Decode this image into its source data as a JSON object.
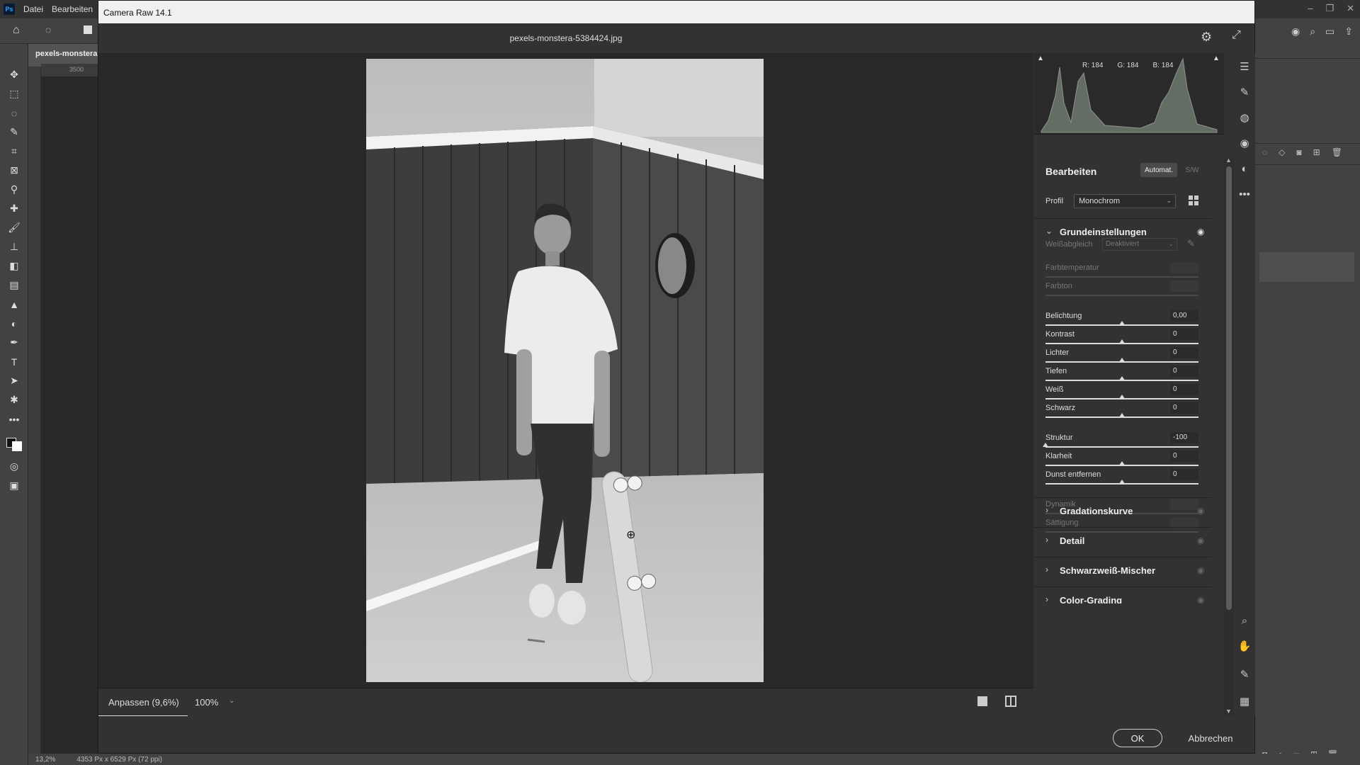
{
  "ps": {
    "logo": "Ps",
    "menu": [
      "Datei",
      "Bearbeiten"
    ],
    "doc_tab": "pexels-monstera",
    "ruler_h_label": "3500",
    "zoom_status": "13,2%",
    "size_status": "4353 Px x 6529 Px (72 ppi)"
  },
  "dialog": {
    "title": "Camera Raw 14.1",
    "filename": "pexels-monstera-5384424.jpg",
    "zoom_fit": "Anpassen (9,6%)",
    "zoom_level": "100%",
    "ok": "OK",
    "cancel": "Abbrechen"
  },
  "histogram": {
    "r": "R: 184",
    "g": "G: 184",
    "b": "B: 184"
  },
  "panel": {
    "title": "Bearbeiten",
    "auto": "Automat.",
    "bw": "S/W",
    "profile_label": "Profil",
    "profile_value": "Monochrom",
    "basic_section": "Grundeinstellungen",
    "wb_label": "Weißabgleich",
    "wb_value": "Deaktiviert",
    "sliders": [
      {
        "label": "Farbtemperatur",
        "value": "",
        "pos": 0.5,
        "disabled": true
      },
      {
        "label": "Farbton",
        "value": "",
        "pos": 0.5,
        "disabled": true
      },
      {
        "label": "Belichtung",
        "value": "0,00",
        "pos": 0.5,
        "disabled": false
      },
      {
        "label": "Kontrast",
        "value": "0",
        "pos": 0.5,
        "disabled": false
      },
      {
        "label": "Lichter",
        "value": "0",
        "pos": 0.5,
        "disabled": false
      },
      {
        "label": "Tiefen",
        "value": "0",
        "pos": 0.5,
        "disabled": false
      },
      {
        "label": "Weiß",
        "value": "0",
        "pos": 0.5,
        "disabled": false
      },
      {
        "label": "Schwarz",
        "value": "0",
        "pos": 0.5,
        "disabled": false
      },
      {
        "label": "Struktur",
        "value": "-100",
        "pos": 0.0,
        "disabled": false
      },
      {
        "label": "Klarheit",
        "value": "0",
        "pos": 0.5,
        "disabled": false
      },
      {
        "label": "Dunst entfernen",
        "value": "0",
        "pos": 0.5,
        "disabled": false
      },
      {
        "label": "Dynamik",
        "value": "",
        "pos": 0.5,
        "disabled": true
      },
      {
        "label": "Sättigung",
        "value": "",
        "pos": 0.5,
        "disabled": true
      }
    ],
    "sections": [
      "Gradationskurve",
      "Detail",
      "Schwarzweiß-Mischer",
      "Color-Grading"
    ]
  }
}
